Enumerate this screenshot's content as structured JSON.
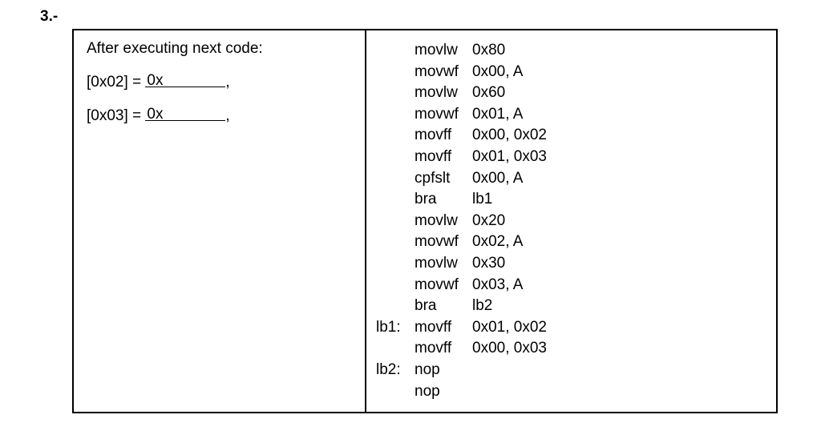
{
  "question": {
    "number": "3.-",
    "prompt": "After executing next code:",
    "blanks": [
      {
        "prefix": "[0x02] = ",
        "underline_text": "0x",
        "suffix": ","
      },
      {
        "prefix": "[0x03] = ",
        "underline_text": "0x",
        "suffix": ","
      }
    ]
  },
  "code": [
    {
      "label": "",
      "op": "movlw",
      "args": "0x80"
    },
    {
      "label": "",
      "op": "movwf",
      "args": "0x00, A"
    },
    {
      "label": "",
      "op": "movlw",
      "args": "0x60"
    },
    {
      "label": "",
      "op": "movwf",
      "args": "0x01, A"
    },
    {
      "label": "",
      "op": "movff",
      "args": "0x00, 0x02"
    },
    {
      "label": "",
      "op": "movff",
      "args": "0x01, 0x03"
    },
    {
      "label": "",
      "op": "cpfslt",
      "args": "0x00, A"
    },
    {
      "label": "",
      "op": "bra",
      "args": "lb1"
    },
    {
      "label": "",
      "op": "movlw",
      "args": "0x20"
    },
    {
      "label": "",
      "op": "movwf",
      "args": "0x02, A"
    },
    {
      "label": "",
      "op": "movlw",
      "args": "0x30"
    },
    {
      "label": "",
      "op": "movwf",
      "args": "0x03, A"
    },
    {
      "label": "",
      "op": "bra",
      "args": "lb2"
    },
    {
      "label": "lb1:",
      "op": "movff",
      "args": "0x01, 0x02"
    },
    {
      "label": "",
      "op": "movff",
      "args": "0x00, 0x03"
    },
    {
      "label": "lb2:",
      "op": "nop",
      "args": ""
    },
    {
      "label": "",
      "op": "nop",
      "args": ""
    }
  ]
}
